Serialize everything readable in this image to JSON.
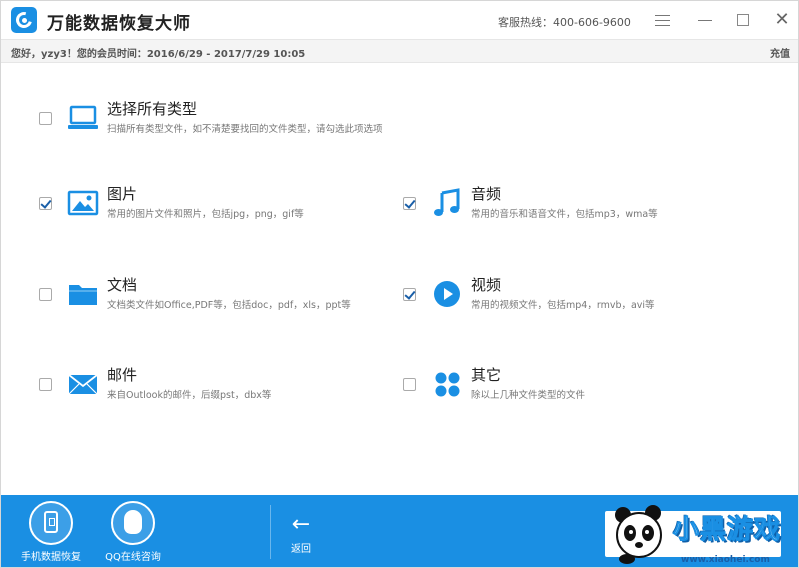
{
  "title_bar": {
    "app_title": "万能数据恢复大师",
    "hotline": "客服热线：400-606-9600",
    "close_glyph": "✕"
  },
  "member_bar": {
    "greeting": "您好，yzy3！您的会员时间：2016/6/29 - 2017/7/29 10:05",
    "recharge": "充值"
  },
  "options": {
    "all": {
      "title": "选择所有类型",
      "desc": "扫描所有类型文件，如不清楚要找回的文件类型，请勾选此项选项",
      "checked": false,
      "icon": "laptop-icon"
    },
    "images": {
      "title": "图片",
      "desc": "常用的图片文件和照片，包括jpg，png，gif等",
      "checked": true,
      "icon": "image-icon"
    },
    "audio": {
      "title": "音频",
      "desc": "常用的音乐和语音文件，包括mp3，wma等",
      "checked": true,
      "icon": "music-note-icon"
    },
    "docs": {
      "title": "文档",
      "desc": "文档类文件如Office,PDF等，包括doc，pdf，xls，ppt等",
      "checked": false,
      "icon": "folder-icon"
    },
    "video": {
      "title": "视频",
      "desc": "常用的视频文件，包括mp4，rmvb，avi等",
      "checked": true,
      "icon": "play-icon"
    },
    "mail": {
      "title": "邮件",
      "desc": "来自Outlook的邮件，后缀pst，dbx等",
      "checked": false,
      "icon": "envelope-icon"
    },
    "other": {
      "title": "其它",
      "desc": "除以上几种文件类型的文件",
      "checked": false,
      "icon": "four-dots-icon"
    }
  },
  "bottom_bar": {
    "phone_recovery": "手机数据恢复",
    "qq_consult": "QQ在线咨询",
    "back": "返回",
    "back_glyph": "←",
    "brand_text": "小黑游戏",
    "brand_url": "www.xiaohei.com"
  },
  "colors": {
    "accent": "#1a8fe3",
    "icon_blue": "#1a8fe3"
  }
}
